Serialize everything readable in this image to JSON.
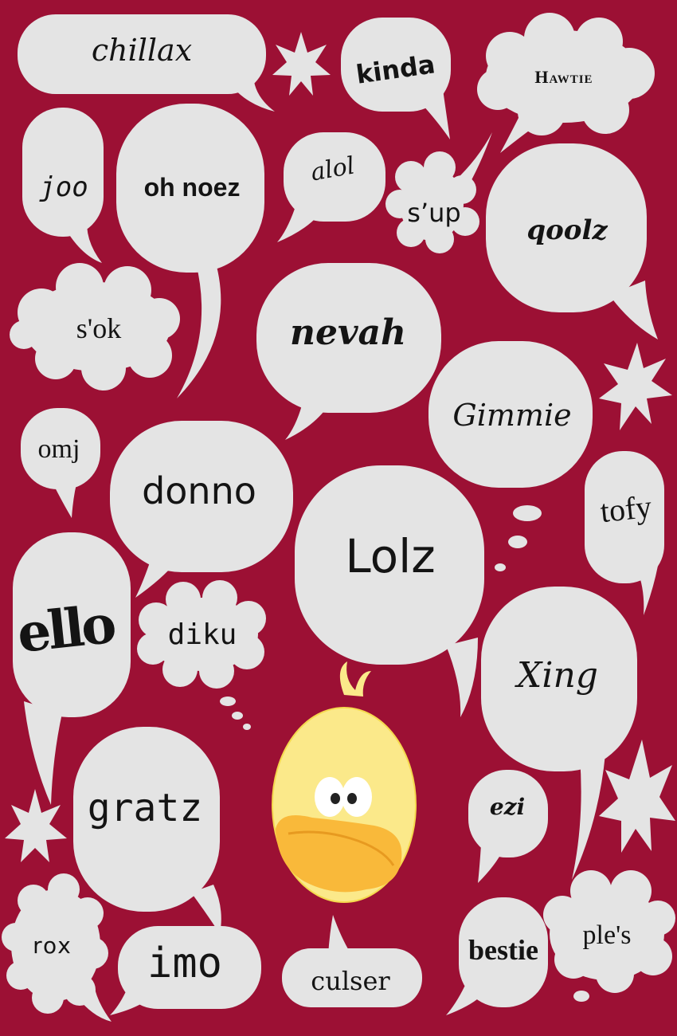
{
  "colors": {
    "background": "#9c1034",
    "bubble": "#e4e4e4",
    "text": "#141414",
    "chick_body": "#fbe98a",
    "chick_beak": "#f9b93a"
  },
  "words": {
    "chillax": "chillax",
    "kinda": "kinda",
    "hawtie": "Hawtie",
    "joo": "joo",
    "oh_noez": "oh noez",
    "alol": "alol",
    "sup": "s’up",
    "qoolz": "qoolz",
    "sok": "s'ok",
    "nevah": "nevah",
    "gimmie": "Gimmie",
    "omj": "omj",
    "donno": "donno",
    "tofy": "tofy",
    "lolz": "Lolz",
    "ello": "ello",
    "diku": "diku",
    "xing": "Xing",
    "gratz": "gratz",
    "ezi": "ezi",
    "rox": "rox",
    "imo": "imo",
    "culser": "culser",
    "bestie": "bestie",
    "ples": "ple's"
  },
  "illustration": {
    "mascot": "yellow chick with big eyes and orange beak",
    "decorations": [
      "starburst",
      "thought-dots"
    ]
  }
}
